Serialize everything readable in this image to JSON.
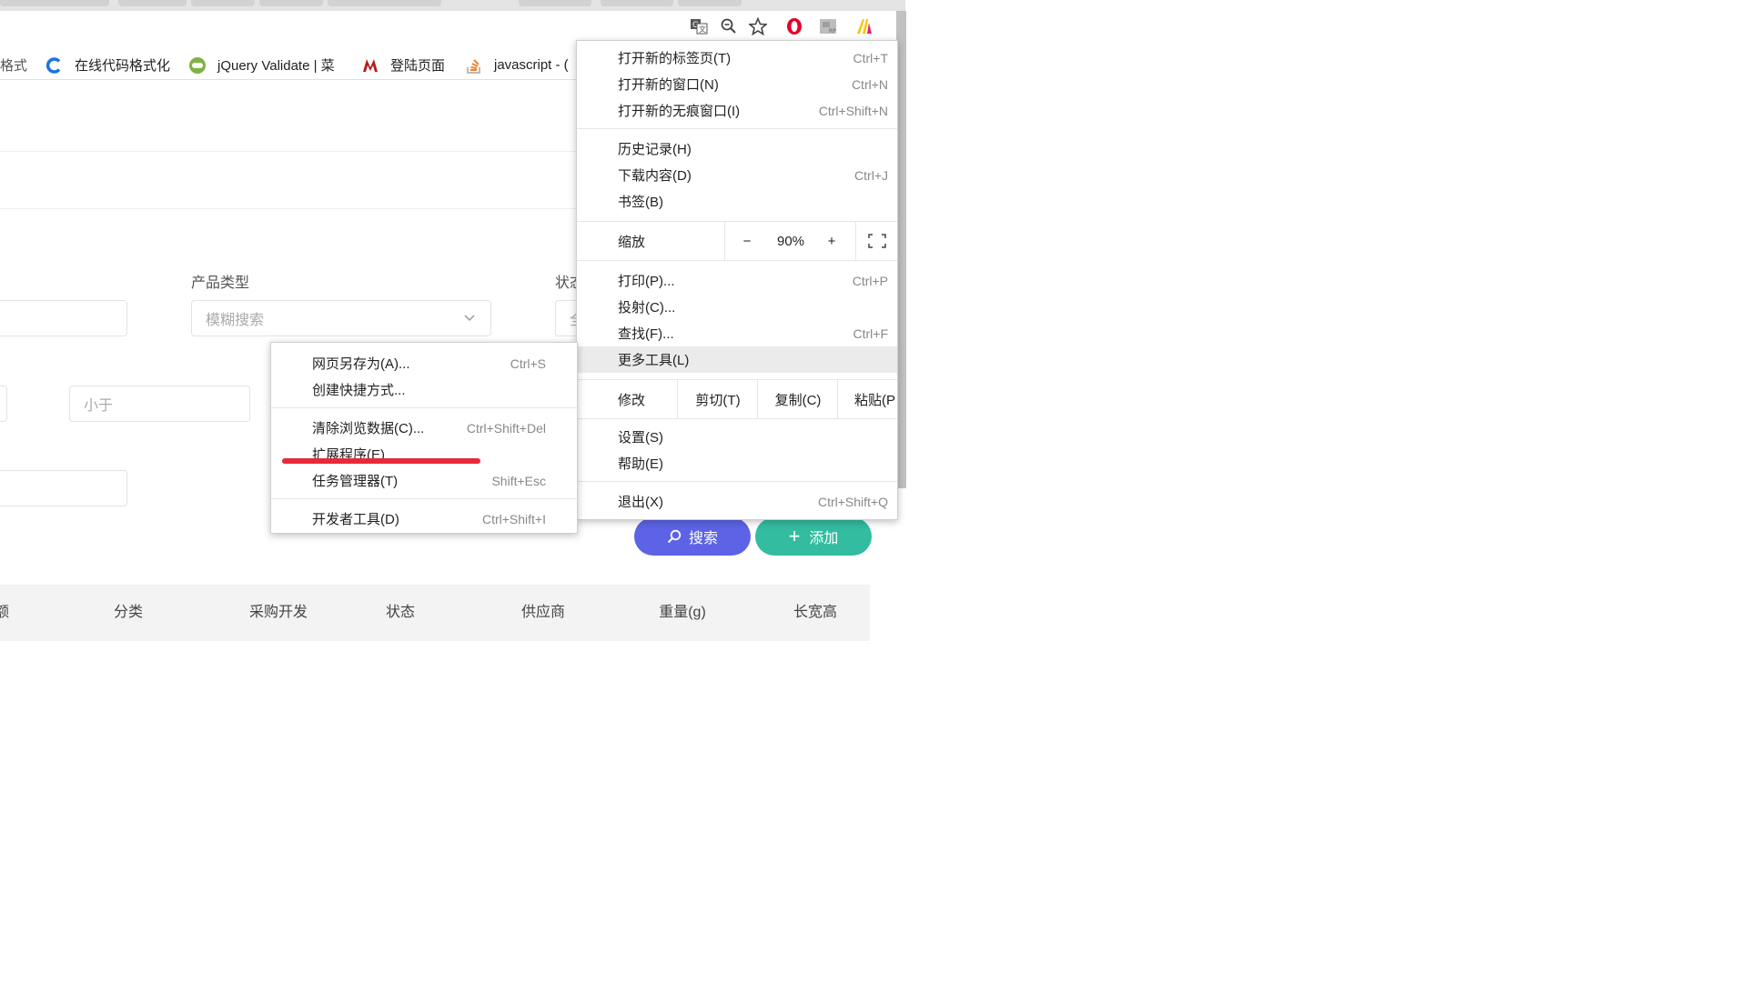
{
  "bookmarks": [
    {
      "label": "格式",
      "icon": "generic-icon"
    },
    {
      "label": "在线代码格式化",
      "icon": "c-logo-icon",
      "color": "#1a73e8"
    },
    {
      "label": "jQuery Validate | 菜",
      "icon": "runoob-icon",
      "color": "#7cb342"
    },
    {
      "label": "登陆页面",
      "icon": "m-logo-icon",
      "color": "#b71c1c"
    },
    {
      "label": "javascript - (",
      "icon": "stackoverflow-icon",
      "color": "#f48024"
    }
  ],
  "toolbar_icons": [
    "translate-icon",
    "zoom-icon",
    "star-icon",
    "opera-icon",
    "extension-icon",
    "yellow-logo-icon"
  ],
  "form": {
    "product_type_label": "产品类型",
    "product_type_placeholder": "模糊搜索",
    "status_label": "状态",
    "status_value_fragment": "全",
    "less_than_placeholder": "小于"
  },
  "buttons": {
    "search": "搜索",
    "add": "添加"
  },
  "colors": {
    "search": "#5c63e6",
    "add": "#33bca0",
    "annotation": "#e8293a"
  },
  "table_headers": [
    "额",
    "分类",
    "采购开发",
    "状态",
    "供应商",
    "重量(g)",
    "长宽高"
  ],
  "main_menu": {
    "new_tab": {
      "label": "打开新的标签页(T)",
      "shortcut": "Ctrl+T"
    },
    "new_window": {
      "label": "打开新的窗口(N)",
      "shortcut": "Ctrl+N"
    },
    "incognito": {
      "label": "打开新的无痕窗口(I)",
      "shortcut": "Ctrl+Shift+N"
    },
    "history": {
      "label": "历史记录(H)"
    },
    "downloads": {
      "label": "下载内容(D)",
      "shortcut": "Ctrl+J"
    },
    "bookmarks": {
      "label": "书签(B)"
    },
    "zoom": {
      "label": "缩放",
      "minus": "−",
      "value": "90%",
      "plus": "+"
    },
    "print": {
      "label": "打印(P)...",
      "shortcut": "Ctrl+P"
    },
    "cast": {
      "label": "投射(C)..."
    },
    "find": {
      "label": "查找(F)...",
      "shortcut": "Ctrl+F"
    },
    "more_tools": {
      "label": "更多工具(L)"
    },
    "edit": {
      "label": "修改",
      "cut": "剪切(T)",
      "copy": "复制(C)",
      "paste": "粘贴(P"
    },
    "settings": {
      "label": "设置(S)"
    },
    "help": {
      "label": "帮助(E)"
    },
    "exit": {
      "label": "退出(X)",
      "shortcut": "Ctrl+Shift+Q"
    }
  },
  "sub_menu": {
    "save_as": {
      "label": "网页另存为(A)...",
      "shortcut": "Ctrl+S"
    },
    "shortcut": {
      "label": "创建快捷方式..."
    },
    "clear_data": {
      "label": "清除浏览数据(C)...",
      "shortcut": "Ctrl+Shift+Del"
    },
    "extensions": {
      "label": "扩展程序(E)"
    },
    "task_manager": {
      "label": "任务管理器(T)",
      "shortcut": "Shift+Esc"
    },
    "devtools": {
      "label": "开发者工具(D)",
      "shortcut": "Ctrl+Shift+I"
    }
  }
}
